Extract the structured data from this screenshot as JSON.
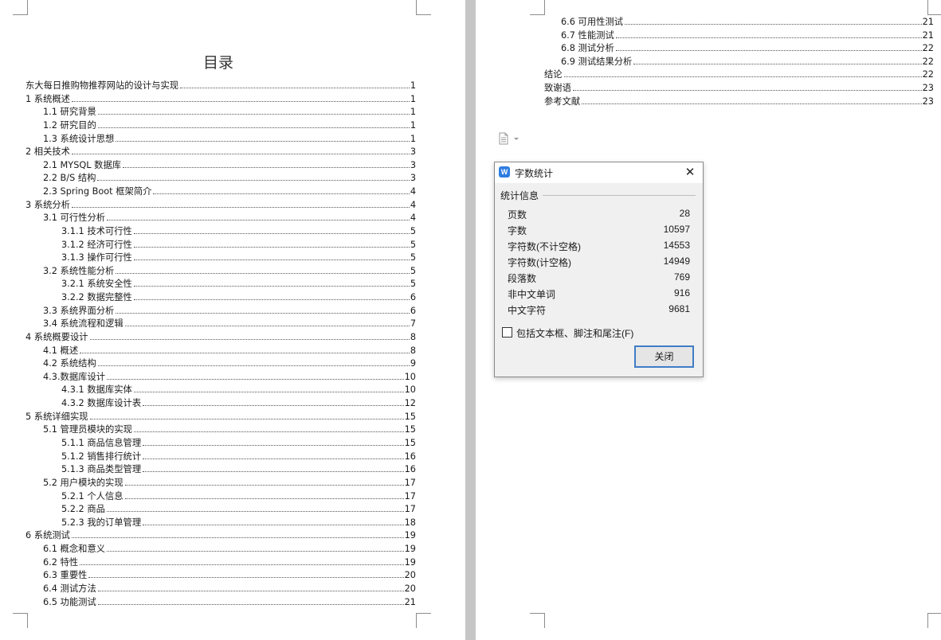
{
  "document": {
    "toc_title": "目录",
    "left_entries": [
      {
        "text": "东大每日推购物推荐网站的设计与实现",
        "page": "1"
      },
      {
        "text": "1 系统概述",
        "page": "1"
      },
      {
        "text": "1.1  研究背景",
        "page": "1"
      },
      {
        "text": "1.2 研究目的",
        "page": "1"
      },
      {
        "text": "1.3 系统设计思想",
        "page": "1"
      },
      {
        "text": "2 相关技术",
        "page": "3"
      },
      {
        "text": "2.1 MYSQL 数据库",
        "page": "3"
      },
      {
        "text": "2.2 B/S 结构",
        "page": "3"
      },
      {
        "text": "2.3 Spring Boot 框架简介",
        "page": "4"
      },
      {
        "text": "3 系统分析",
        "page": "4"
      },
      {
        "text": "3.1 可行性分析",
        "page": "4"
      },
      {
        "text": "3.1.1 技术可行性",
        "page": "5"
      },
      {
        "text": "3.1.2 经济可行性",
        "page": "5"
      },
      {
        "text": "3.1.3 操作可行性",
        "page": "5"
      },
      {
        "text": "3.2 系统性能分析",
        "page": "5"
      },
      {
        "text": "3.2.1  系统安全性",
        "page": "5"
      },
      {
        "text": "3.2.2  数据完整性",
        "page": "6"
      },
      {
        "text": "3.3 系统界面分析",
        "page": "6"
      },
      {
        "text": "3.4 系统流程和逻辑",
        "page": "7"
      },
      {
        "text": "4 系统概要设计",
        "page": "8"
      },
      {
        "text": "4.1 概述",
        "page": "8"
      },
      {
        "text": "4.2 系统结构",
        "page": "9"
      },
      {
        "text": "4.3.数据库设计",
        "page": "10"
      },
      {
        "text": "4.3.1 数据库实体",
        "page": "10"
      },
      {
        "text": "4.3.2 数据库设计表",
        "page": "12"
      },
      {
        "text": "5 系统详细实现",
        "page": "15"
      },
      {
        "text": "5.1  管理员模块的实现",
        "page": "15"
      },
      {
        "text": "5.1.1  商品信息管理",
        "page": "15"
      },
      {
        "text": "5.1.2  销售排行统计",
        "page": "16"
      },
      {
        "text": "5.1.3  商品类型管理",
        "page": "16"
      },
      {
        "text": "5.2  用户模块的实现",
        "page": "17"
      },
      {
        "text": "5.2.1  个人信息",
        "page": "17"
      },
      {
        "text": "5.2.2  商品",
        "page": "17"
      },
      {
        "text": "5.2.3  我的订单管理",
        "page": "18"
      },
      {
        "text": "6 系统测试",
        "page": "19"
      },
      {
        "text": "6.1 概念和意义",
        "page": "19"
      },
      {
        "text": "6.2 特性",
        "page": "19"
      },
      {
        "text": "6.3 重要性",
        "page": "20"
      },
      {
        "text": "6.4 测试方法",
        "page": "20"
      },
      {
        "text": "6.5  功能测试",
        "page": "21"
      }
    ],
    "right_entries": [
      {
        "text": "6.6 可用性测试",
        "page": "21"
      },
      {
        "text": "6.7 性能测试",
        "page": "21"
      },
      {
        "text": "6.8 测试分析",
        "page": "22"
      },
      {
        "text": "6.9 测试结果分析",
        "page": "22"
      },
      {
        "text": "结论",
        "page": "22"
      },
      {
        "text": "致谢语",
        "page": "23"
      },
      {
        "text": "参考文献",
        "page": "23"
      }
    ]
  },
  "dialog": {
    "title": "字数统计",
    "group_label": "统计信息",
    "stats": [
      {
        "label": "页数",
        "value": "28"
      },
      {
        "label": "字数",
        "value": "10597"
      },
      {
        "label": "字符数(不计空格)",
        "value": "14553"
      },
      {
        "label": "字符数(计空格)",
        "value": "14949"
      },
      {
        "label": "段落数",
        "value": "769"
      },
      {
        "label": "非中文单词",
        "value": "916"
      },
      {
        "label": "中文字符",
        "value": "9681"
      }
    ],
    "checkbox_label": "包括文本框、脚注和尾注(F)",
    "checkbox_checked": false,
    "close_button_label": "关闭"
  },
  "colors": {
    "gutter": "#c6c6c6",
    "dialog_bg": "#f0f0f0",
    "button_border": "#3f7dc6",
    "app_icon": "#2f7de1"
  },
  "icons": [
    "paste-options-icon",
    "wps-app-icon",
    "close-icon"
  ]
}
